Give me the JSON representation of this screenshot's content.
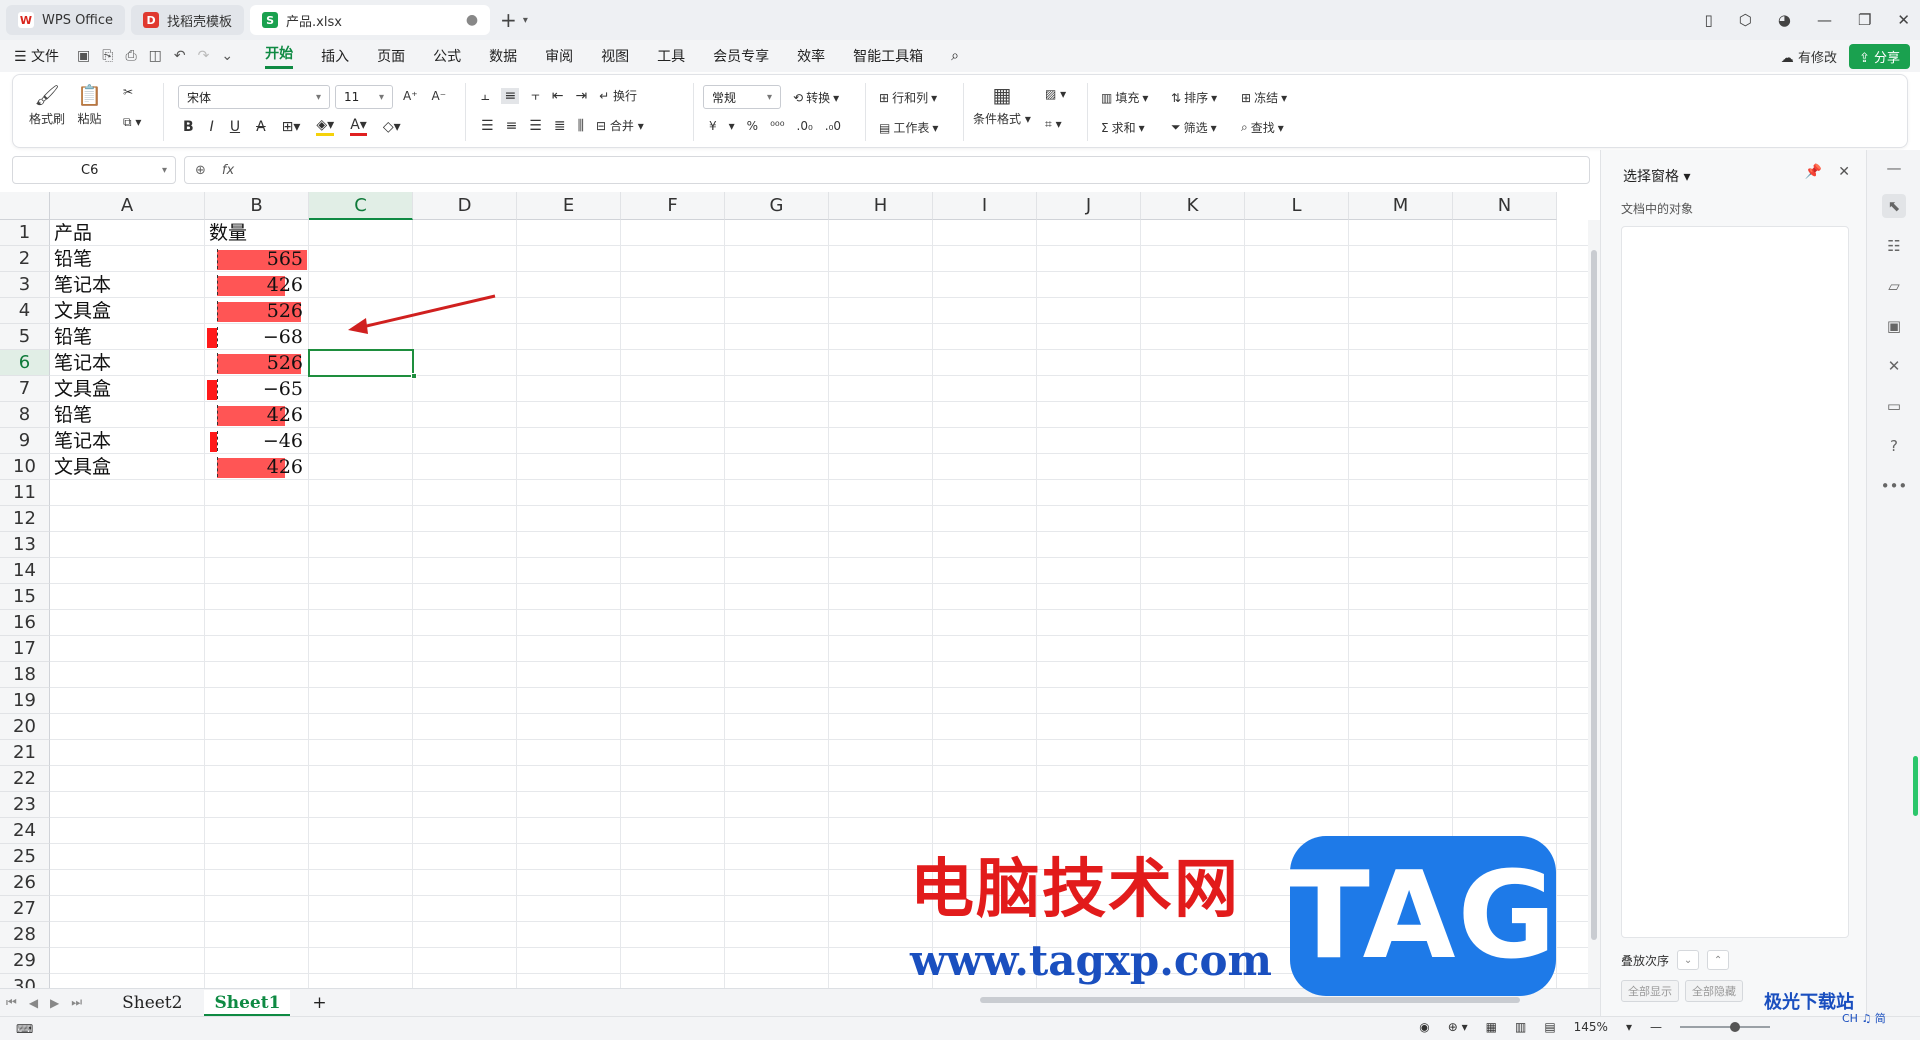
{
  "tabs": [
    {
      "label": "WPS Office",
      "icon": "wps-logo-icon",
      "color": "#d9241c",
      "glyph": "W"
    },
    {
      "label": "找稻壳模板",
      "icon": "docer-logo-icon",
      "color": "#e0392f",
      "glyph": "D"
    },
    {
      "label": "产品.xlsx",
      "icon": "spreadsheet-icon",
      "color": "#1aa14f",
      "glyph": "S",
      "active": true
    }
  ],
  "menu": {
    "file": "文件",
    "items": [
      "开始",
      "插入",
      "页面",
      "公式",
      "数据",
      "审阅",
      "视图",
      "工具",
      "会员专享",
      "效率",
      "智能工具箱"
    ],
    "active": "开始",
    "modify": "有修改",
    "share": "分享"
  },
  "ribbon": {
    "format_painter": "格式刷",
    "paste": "粘贴",
    "font_name": "宋体",
    "font_size": "11",
    "wrap": "换行",
    "merge": "合并",
    "number_format": "常规",
    "convert": "转换",
    "rows_cols": "行和列",
    "worksheet": "工作表",
    "cond_format": "条件格式",
    "fill": "填充",
    "sort": "排序",
    "freeze": "冻结",
    "sum": "求和",
    "filter": "筛选",
    "find": "查找",
    "currency": "¥",
    "percent": "%"
  },
  "formula_bar": {
    "name_box": "C6",
    "fx": "fx",
    "value": ""
  },
  "columns": [
    "A",
    "B",
    "C",
    "D",
    "E",
    "F",
    "G",
    "H",
    "I",
    "J",
    "K",
    "L",
    "M",
    "N"
  ],
  "rows": [
    "1",
    "2",
    "3",
    "4",
    "5",
    "6",
    "7",
    "8",
    "9",
    "10",
    "11",
    "12",
    "13",
    "14",
    "15",
    "16",
    "17",
    "18",
    "19",
    "20",
    "21",
    "22",
    "23",
    "24",
    "25",
    "26",
    "27",
    "28",
    "29",
    "30"
  ],
  "selected_cell": "C6",
  "cells": {
    "header_a": "产品",
    "header_b": "数量",
    "data": [
      {
        "product": "铅笔",
        "qty": 565
      },
      {
        "product": "笔记本",
        "qty": 426
      },
      {
        "product": "文具盒",
        "qty": 526
      },
      {
        "product": "铅笔",
        "qty": -68
      },
      {
        "product": "笔记本",
        "qty": 526
      },
      {
        "product": "文具盒",
        "qty": -65
      },
      {
        "product": "铅笔",
        "qty": 426
      },
      {
        "product": "笔记本",
        "qty": -46
      },
      {
        "product": "文具盒",
        "qty": 426
      }
    ],
    "data_bar_color": "#ff5555",
    "negative_bar_color": "#ff1a1a"
  },
  "sheets": [
    "Sheet2",
    "Sheet1"
  ],
  "active_sheet": "Sheet1",
  "add_sheet": "+",
  "status": {
    "zoom": "145%"
  },
  "pane": {
    "title": "选择窗格",
    "subtitle": "文档中的对象",
    "order_label": "叠放次序",
    "show_all": "全部显示",
    "hide_all": "全部隐藏"
  },
  "watermark": {
    "cn": "电脑技术网",
    "url": "www.tagxp.com",
    "tag": "TAG",
    "corner": "极光下载站",
    "corner_sub": "CH ♫ 简"
  },
  "accent_color": "#0f8a43"
}
